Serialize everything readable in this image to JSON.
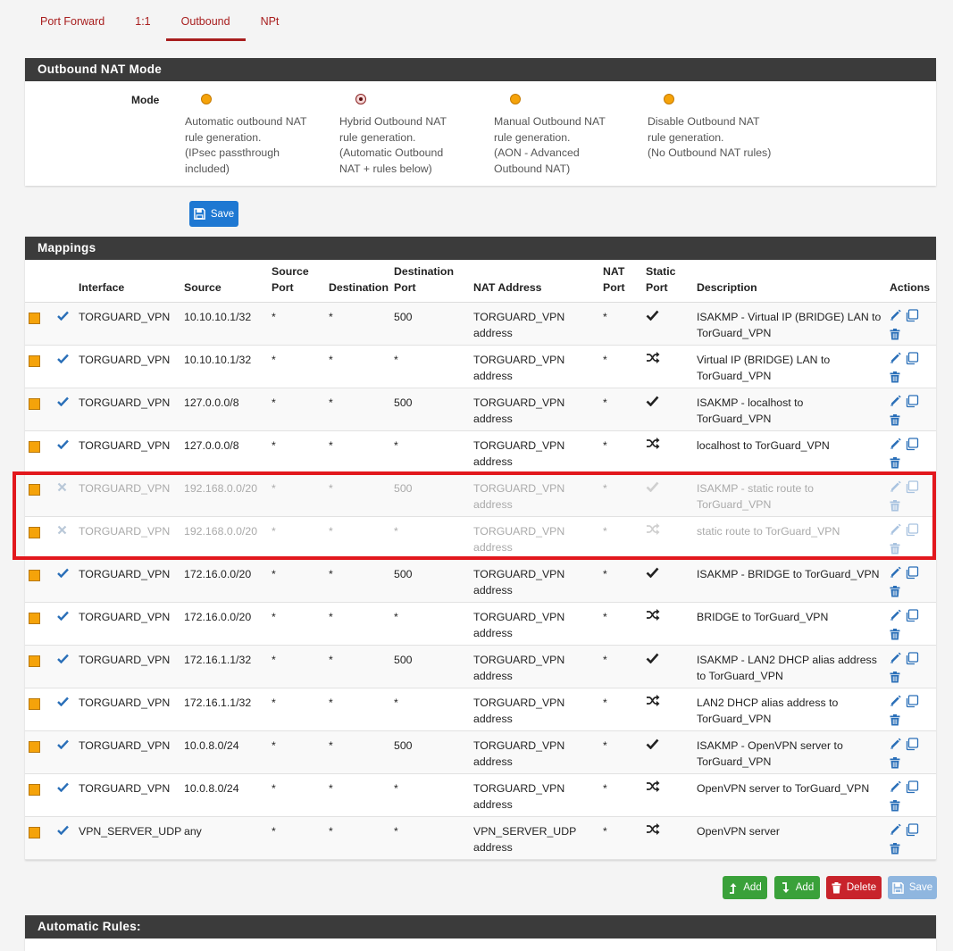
{
  "tabs": [
    {
      "label": "Port Forward",
      "active": false
    },
    {
      "label": "1:1",
      "active": false
    },
    {
      "label": "Outbound",
      "active": true
    },
    {
      "label": "NPt",
      "active": false
    }
  ],
  "nat_mode": {
    "title": "Outbound NAT Mode",
    "mode_label": "Mode",
    "options": [
      {
        "lines": [
          "Automatic outbound NAT",
          "rule generation.",
          "(IPsec passthrough",
          "included)"
        ],
        "checked": false
      },
      {
        "lines": [
          "Hybrid Outbound NAT",
          "rule generation.",
          "(Automatic Outbound",
          "NAT + rules below)"
        ],
        "checked": true
      },
      {
        "lines": [
          "Manual Outbound NAT",
          "rule generation.",
          "(AON - Advanced",
          "Outbound NAT)"
        ],
        "checked": false
      },
      {
        "lines": [
          "Disable Outbound NAT",
          "rule generation.",
          "(No Outbound NAT rules)"
        ],
        "checked": false
      }
    ],
    "save_label": "Save"
  },
  "mappings": {
    "title": "Mappings",
    "columns": {
      "interface": "Interface",
      "source": "Source",
      "source_port": [
        "Source",
        "Port"
      ],
      "destination": "Destination",
      "destination_port": [
        "Destination",
        "Port"
      ],
      "nat_address": "NAT Address",
      "nat_port": [
        "NAT",
        "Port"
      ],
      "static_port": [
        "Static",
        "Port"
      ],
      "description": "Description",
      "actions": "Actions"
    },
    "rows": [
      {
        "enabled": true,
        "interface": "TORGUARD_VPN",
        "source": "10.10.10.1/32",
        "source_port": "*",
        "destination": "*",
        "destination_port": "500",
        "nat_address": [
          "TORGUARD_VPN",
          "address"
        ],
        "nat_port": "*",
        "static": "check",
        "description": [
          "ISAKMP - Virtual IP (BRIDGE) LAN to",
          "TorGuard_VPN"
        ]
      },
      {
        "enabled": true,
        "interface": "TORGUARD_VPN",
        "source": "10.10.10.1/32",
        "source_port": "*",
        "destination": "*",
        "destination_port": "*",
        "nat_address": [
          "TORGUARD_VPN",
          "address"
        ],
        "nat_port": "*",
        "static": "shuffle",
        "description": [
          "Virtual IP (BRIDGE) LAN to",
          "TorGuard_VPN"
        ]
      },
      {
        "enabled": true,
        "interface": "TORGUARD_VPN",
        "source": "127.0.0.0/8",
        "source_port": "*",
        "destination": "*",
        "destination_port": "500",
        "nat_address": [
          "TORGUARD_VPN",
          "address"
        ],
        "nat_port": "*",
        "static": "check",
        "description": [
          "ISAKMP - localhost to",
          "TorGuard_VPN"
        ]
      },
      {
        "enabled": true,
        "interface": "TORGUARD_VPN",
        "source": "127.0.0.0/8",
        "source_port": "*",
        "destination": "*",
        "destination_port": "*",
        "nat_address": [
          "TORGUARD_VPN",
          "address"
        ],
        "nat_port": "*",
        "static": "shuffle",
        "description": [
          "localhost to TorGuard_VPN"
        ]
      },
      {
        "enabled": false,
        "interface": "TORGUARD_VPN",
        "source": "192.168.0.0/20",
        "source_port": "*",
        "destination": "*",
        "destination_port": "500",
        "nat_address": [
          "TORGUARD_VPN",
          "address"
        ],
        "nat_port": "*",
        "static": "check",
        "description": [
          "ISAKMP - static route to",
          "TorGuard_VPN"
        ]
      },
      {
        "enabled": false,
        "interface": "TORGUARD_VPN",
        "source": "192.168.0.0/20",
        "source_port": "*",
        "destination": "*",
        "destination_port": "*",
        "nat_address": [
          "TORGUARD_VPN",
          "address"
        ],
        "nat_port": "*",
        "static": "shuffle",
        "description": [
          "static route to TorGuard_VPN"
        ]
      },
      {
        "enabled": true,
        "interface": "TORGUARD_VPN",
        "source": "172.16.0.0/20",
        "source_port": "*",
        "destination": "*",
        "destination_port": "500",
        "nat_address": [
          "TORGUARD_VPN",
          "address"
        ],
        "nat_port": "*",
        "static": "check",
        "description": [
          "ISAKMP - BRIDGE to TorGuard_VPN"
        ]
      },
      {
        "enabled": true,
        "interface": "TORGUARD_VPN",
        "source": "172.16.0.0/20",
        "source_port": "*",
        "destination": "*",
        "destination_port": "*",
        "nat_address": [
          "TORGUARD_VPN",
          "address"
        ],
        "nat_port": "*",
        "static": "shuffle",
        "description": [
          "BRIDGE to TorGuard_VPN"
        ]
      },
      {
        "enabled": true,
        "interface": "TORGUARD_VPN",
        "source": "172.16.1.1/32",
        "source_port": "*",
        "destination": "*",
        "destination_port": "500",
        "nat_address": [
          "TORGUARD_VPN",
          "address"
        ],
        "nat_port": "*",
        "static": "check",
        "description": [
          "ISAKMP - LAN2 DHCP alias address",
          "to TorGuard_VPN"
        ]
      },
      {
        "enabled": true,
        "interface": "TORGUARD_VPN",
        "source": "172.16.1.1/32",
        "source_port": "*",
        "destination": "*",
        "destination_port": "*",
        "nat_address": [
          "TORGUARD_VPN",
          "address"
        ],
        "nat_port": "*",
        "static": "shuffle",
        "description": [
          "LAN2 DHCP alias address to",
          "TorGuard_VPN"
        ]
      },
      {
        "enabled": true,
        "interface": "TORGUARD_VPN",
        "source": "10.0.8.0/24",
        "source_port": "*",
        "destination": "*",
        "destination_port": "500",
        "nat_address": [
          "TORGUARD_VPN",
          "address"
        ],
        "nat_port": "*",
        "static": "check",
        "description": [
          "ISAKMP - OpenVPN server to",
          "TorGuard_VPN"
        ]
      },
      {
        "enabled": true,
        "interface": "TORGUARD_VPN",
        "source": "10.0.8.0/24",
        "source_port": "*",
        "destination": "*",
        "destination_port": "*",
        "nat_address": [
          "TORGUARD_VPN",
          "address"
        ],
        "nat_port": "*",
        "static": "shuffle",
        "description": [
          "OpenVPN server to TorGuard_VPN"
        ]
      },
      {
        "enabled": true,
        "interface": "VPN_SERVER_UDP",
        "source": "any",
        "source_port": "*",
        "destination": "*",
        "destination_port": "*",
        "nat_address": [
          "VPN_SERVER_UDP",
          "address"
        ],
        "nat_port": "*",
        "static": "shuffle",
        "description": [
          "OpenVPN server"
        ]
      }
    ]
  },
  "footer_buttons": {
    "add_top": "Add",
    "add_bottom": "Add",
    "delete": "Delete",
    "save": "Save"
  },
  "automatic_rules": {
    "title": "Automatic Rules:"
  },
  "colors": {
    "accent": "#a81e1e",
    "panel_header": "#3b3b3b",
    "checkmark_blue": "#2a6fb8",
    "handle_orange": "#f5a30a",
    "highlight_red": "#e2181d"
  }
}
